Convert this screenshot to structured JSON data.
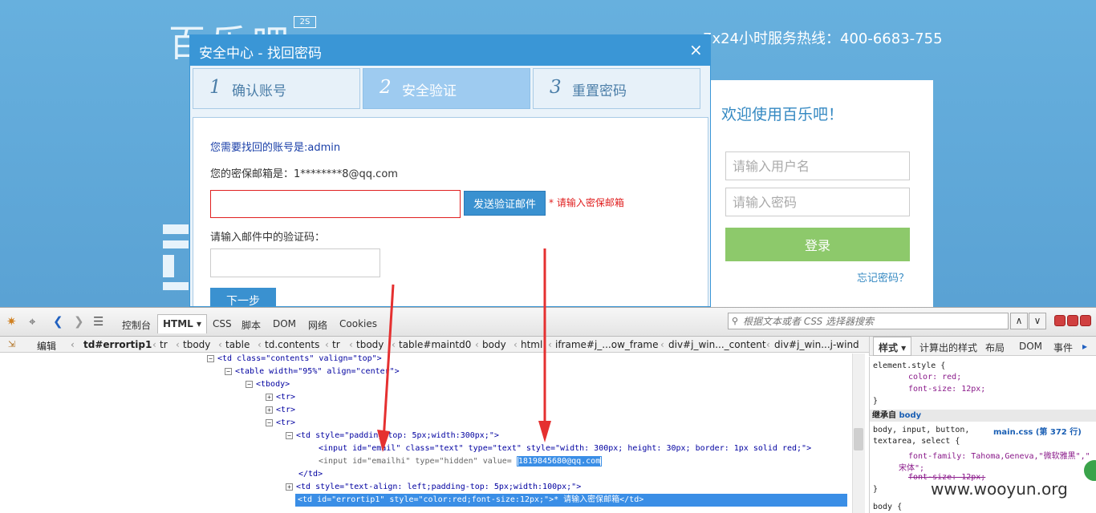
{
  "background": {
    "logo_text": "百乐吧",
    "badge": "2S",
    "hotline": "7x24小时服务热线：400-6683-755",
    "login": {
      "title": "欢迎使用百乐吧！",
      "username_placeholder": "请输入用户名",
      "password_placeholder": "请输入密码",
      "login_button": "登录",
      "forgot_link": "忘记密码？"
    }
  },
  "modal": {
    "title": "安全中心 - 找回密码",
    "close": "×",
    "steps": [
      {
        "num": "1",
        "label": "确认账号"
      },
      {
        "num": "2",
        "label": "安全验证"
      },
      {
        "num": "3",
        "label": "重置密码"
      }
    ],
    "account_text": "您需要找回的账号是:admin",
    "email_text": "您的密保邮箱是：1********8@qq.com",
    "send_button": "发送验证邮件",
    "error_tip": "* 请输入密保邮箱",
    "code_label": "请输入邮件中的验证码：",
    "next_button": "下一步"
  },
  "devtools": {
    "toolbar_tabs": [
      "控制台",
      "HTML ▾",
      "CSS",
      "脚本",
      "DOM",
      "网络",
      "Cookies"
    ],
    "search_placeholder": "根据文本或者 CSS 选择器搜索",
    "edit_label": "编辑",
    "breadcrumbs": [
      "td#errortip1",
      "tr",
      "tbody",
      "table",
      "td.contents",
      "tr",
      "tbody",
      "table#maintd0",
      "body",
      "html",
      "iframe#j_...ow_frame",
      "div#j_win..._content",
      "div#j_win...j-wind"
    ],
    "side_tabs": [
      "样式 ▾",
      "计算出的样式",
      "布局",
      "DOM",
      "事件"
    ],
    "tree": {
      "l1": "<td  class=\"contents\"  valign=\"top\">",
      "l2": "<table  width=\"95%\"  align=\"center\">",
      "l3": "<tbody>",
      "l4": "<tr>",
      "l5": "<tr>",
      "l6": "<tr>",
      "l7": "<td  style=\"padding-top: 5px;width:300px;\">",
      "l8": "<input  id=\"email\"  class=\"text\"  type=\"text\"  style=\"width: 300px; height: 30px; border: 1px solid red;\">",
      "l9a": "<input  id=\"emailhi\"  type=\"hidden\"  value=",
      "l9v": "1819845680@qq.com",
      "l10": "</td>",
      "l11": "<td  style=\"text-align: left;padding-top: 5px;width:100px;\">",
      "l12": "<td  id=\"errortip1\"  style=\"color:red;font-size:12px;\">*  请输入密保邮箱</td>"
    },
    "styles": {
      "s1": "element.style {",
      "s2": "color: red;",
      "s3": "font-size: 12px;",
      "s4": "}",
      "inherit": "继承自",
      "inherit_from": "body",
      "s5": "body, input, button,",
      "s5link": "main.css (第 372 行)",
      "s6": "textarea, select {",
      "s7": "font-family: Tahoma,Geneva,\"微软雅黑\",\"",
      "s8": "宋体\";",
      "s9": "font-size: 12px;",
      "s10": "}",
      "s11": "body {"
    }
  },
  "watermark": "www.wooyun.org",
  "colors": {
    "accent": "#3a96d6",
    "error": "#e02020",
    "login_button": "#8dc96b"
  }
}
